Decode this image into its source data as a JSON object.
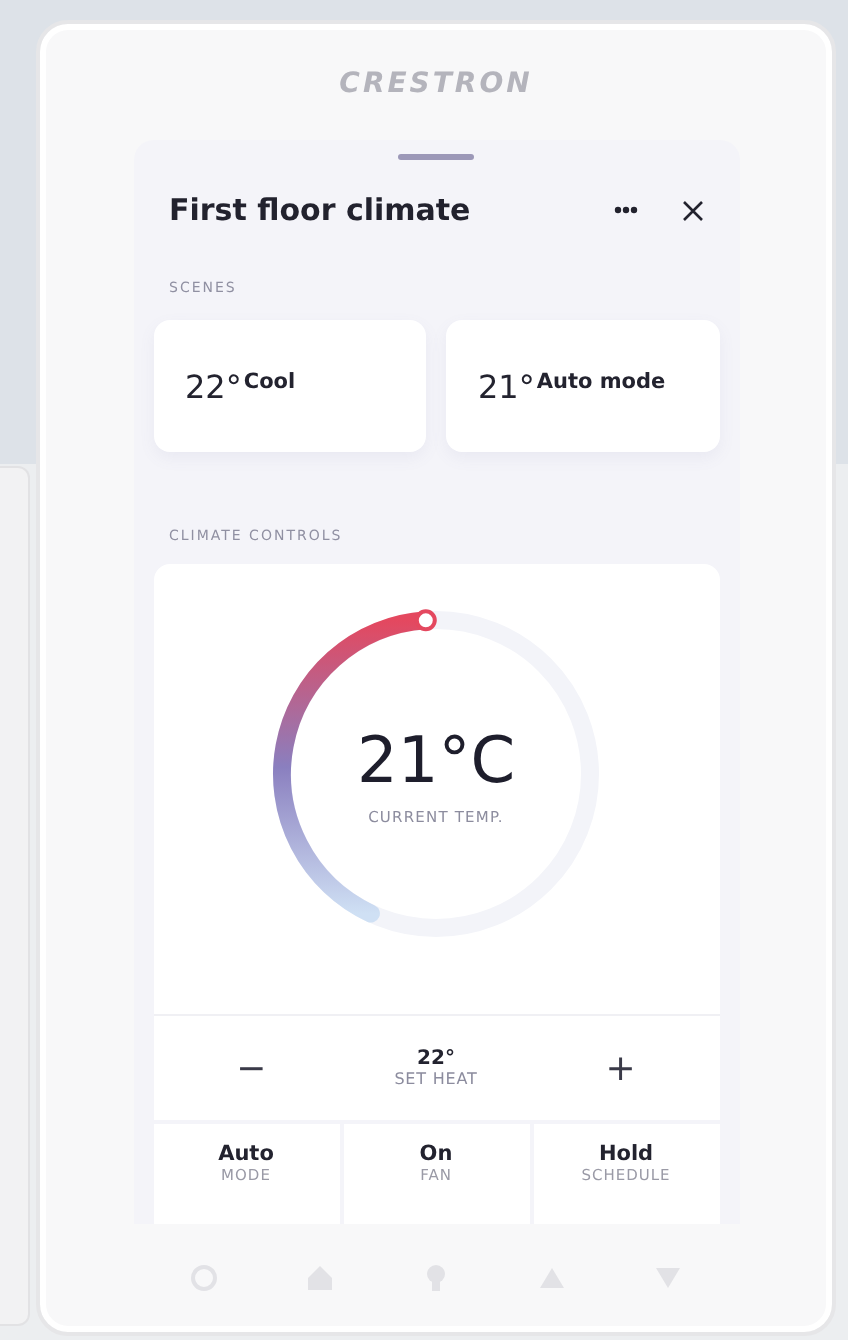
{
  "device": {
    "brand": "CRESTRON"
  },
  "panel": {
    "title": "First floor climate"
  },
  "scenes": {
    "heading": "SCENES",
    "items": [
      {
        "temp": "22°",
        "label": "Cool"
      },
      {
        "temp": "21°",
        "label": "Auto mode"
      }
    ]
  },
  "climate": {
    "heading": "CLIMATE CONTROLS",
    "dial": {
      "level": 0.42,
      "value": "21°C",
      "caption": "CURRENT TEMP."
    },
    "setpoint": {
      "decrease": "−",
      "value": "22°",
      "caption": "SET HEAT",
      "increase": "+"
    },
    "modes": [
      {
        "value": "Auto",
        "caption": "MODE"
      },
      {
        "value": "On",
        "caption": "FAN"
      },
      {
        "value": "Hold",
        "caption": "SCHEDULE"
      }
    ]
  }
}
